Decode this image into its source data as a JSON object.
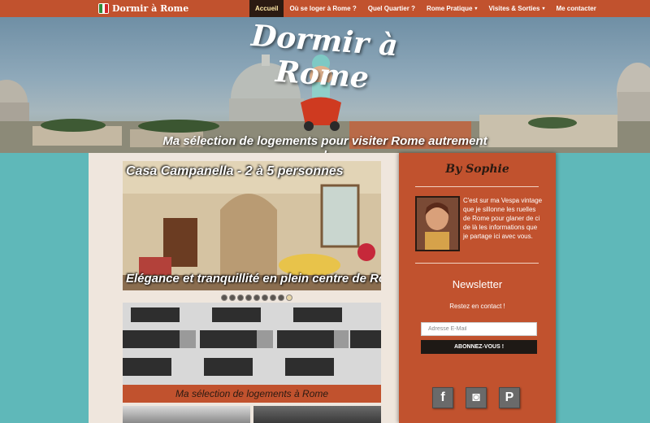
{
  "nav": {
    "brand": "Dormir à Rome",
    "items": [
      {
        "label": "Accueil",
        "active": true,
        "caret": ""
      },
      {
        "label": "Où se loger à Rome ?",
        "active": false,
        "caret": ""
      },
      {
        "label": "Quel Quartier ?",
        "active": false,
        "caret": ""
      },
      {
        "label": "Rome Pratique",
        "active": false,
        "caret": "▾"
      },
      {
        "label": "Visites & Sorties",
        "active": false,
        "caret": "▾"
      },
      {
        "label": "Me contacter",
        "active": false,
        "caret": ""
      }
    ]
  },
  "hero": {
    "title": "Dormir à Rome",
    "tagline": "Ma sélection de logements pour visiter Rome autrement !"
  },
  "slider": {
    "title": "Casa Campanella  - 2 à 5 personnes",
    "caption": "Elégance et tranquillité en plein centre de Rome",
    "dot_count": 9,
    "active_dot": 8
  },
  "card": {
    "caption": "Ma sélection de logements à Rome"
  },
  "sidebar": {
    "author_title": "By Sophie",
    "bio": "C'est sur ma Vespa vintage que je sillonne les ruelles de Rome pour glaner de ci de là les informations que je partage ici avec vous.",
    "newsletter_title": "Newsletter",
    "newsletter_subtitle": "Restez en contact !",
    "email_placeholder": "Adresse E-Mail",
    "subscribe_label": "ABONNEZ-VOUS !",
    "socials": [
      {
        "name": "facebook-icon",
        "glyph": "f"
      },
      {
        "name": "instagram-icon",
        "glyph": "◙"
      },
      {
        "name": "pinterest-icon",
        "glyph": "P"
      }
    ]
  },
  "colors": {
    "accent": "#c1522e",
    "background": "#5fb8b9",
    "content": "#efe6dd",
    "dark": "#1e1915"
  }
}
